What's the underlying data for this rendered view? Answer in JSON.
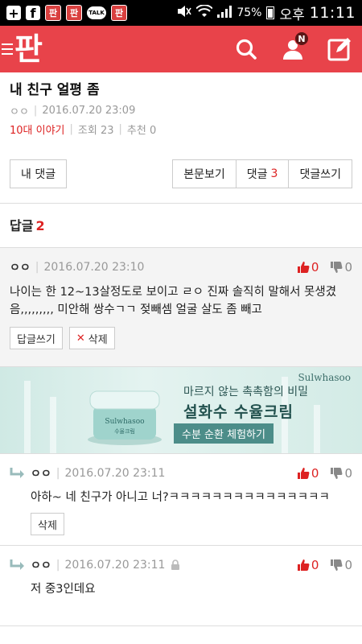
{
  "status_bar": {
    "battery": "75%",
    "ampm": "오후",
    "time": "11:11",
    "pann_label": "판",
    "talk_label": "TALK"
  },
  "header": {
    "logo": "판",
    "notif_badge": "N",
    "accent": "#e8434a"
  },
  "post": {
    "title": "내 친구 얼평 좀",
    "author": "ㅇㅇ",
    "datetime": "2016.07.20 23:09",
    "category": "10대 이야기",
    "views": "조회 23",
    "recommend": "추천 0"
  },
  "tabs": {
    "my_comments": "내 댓글",
    "view_post": "본문보기",
    "comments_label": "댓글",
    "comments_count": "3",
    "write_comment": "댓글쓰기"
  },
  "replies": {
    "label": "답글",
    "count": "2"
  },
  "comment1": {
    "author": "ㅇㅇ",
    "datetime": "2016.07.20 23:10",
    "up": "0",
    "down": "0",
    "body_line1": "나이는 한 12~13살정도로 보이고 ㄹㅇ 진짜 솔직히 말해서 못생겼",
    "body_line2": "음,,,,,,,,, 미안해 쌍수ㄱㄱ 젖빼셈 얼굴 살도 좀 빼고",
    "reply_btn": "답글쓰기",
    "delete_btn": "삭제"
  },
  "ad": {
    "brand": "Sulwhasoo",
    "tagline": "마르지 않는 촉촉함의 비밀",
    "product": "설화수 수율크림",
    "cta": "수분 순환 체험하기",
    "jar_brand": "Sulwhasoo",
    "jar_sub": "수율크림"
  },
  "reply1": {
    "author": "ㅇㅇ",
    "datetime": "2016.07.20 23:11",
    "up": "0",
    "down": "0",
    "body": "아하~ 네 친구가 아니고 너?ㅋㅋㅋㅋㅋㅋㅋㅋㅋㅋㅋㅋㅋㅋㅋ",
    "delete_btn": "삭제"
  },
  "reply2": {
    "author": "ㅇㅇ",
    "datetime": "2016.07.20 23:11",
    "up": "0",
    "down": "0",
    "body": "저 중3인데요"
  }
}
